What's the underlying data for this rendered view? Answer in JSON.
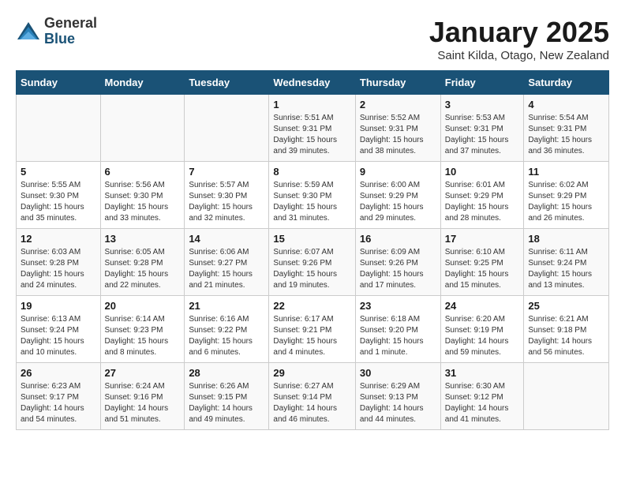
{
  "header": {
    "logo_general": "General",
    "logo_blue": "Blue",
    "month": "January 2025",
    "location": "Saint Kilda, Otago, New Zealand"
  },
  "days_of_week": [
    "Sunday",
    "Monday",
    "Tuesday",
    "Wednesday",
    "Thursday",
    "Friday",
    "Saturday"
  ],
  "weeks": [
    [
      {
        "day": "",
        "info": ""
      },
      {
        "day": "",
        "info": ""
      },
      {
        "day": "",
        "info": ""
      },
      {
        "day": "1",
        "info": "Sunrise: 5:51 AM\nSunset: 9:31 PM\nDaylight: 15 hours\nand 39 minutes."
      },
      {
        "day": "2",
        "info": "Sunrise: 5:52 AM\nSunset: 9:31 PM\nDaylight: 15 hours\nand 38 minutes."
      },
      {
        "day": "3",
        "info": "Sunrise: 5:53 AM\nSunset: 9:31 PM\nDaylight: 15 hours\nand 37 minutes."
      },
      {
        "day": "4",
        "info": "Sunrise: 5:54 AM\nSunset: 9:31 PM\nDaylight: 15 hours\nand 36 minutes."
      }
    ],
    [
      {
        "day": "5",
        "info": "Sunrise: 5:55 AM\nSunset: 9:30 PM\nDaylight: 15 hours\nand 35 minutes."
      },
      {
        "day": "6",
        "info": "Sunrise: 5:56 AM\nSunset: 9:30 PM\nDaylight: 15 hours\nand 33 minutes."
      },
      {
        "day": "7",
        "info": "Sunrise: 5:57 AM\nSunset: 9:30 PM\nDaylight: 15 hours\nand 32 minutes."
      },
      {
        "day": "8",
        "info": "Sunrise: 5:59 AM\nSunset: 9:30 PM\nDaylight: 15 hours\nand 31 minutes."
      },
      {
        "day": "9",
        "info": "Sunrise: 6:00 AM\nSunset: 9:29 PM\nDaylight: 15 hours\nand 29 minutes."
      },
      {
        "day": "10",
        "info": "Sunrise: 6:01 AM\nSunset: 9:29 PM\nDaylight: 15 hours\nand 28 minutes."
      },
      {
        "day": "11",
        "info": "Sunrise: 6:02 AM\nSunset: 9:29 PM\nDaylight: 15 hours\nand 26 minutes."
      }
    ],
    [
      {
        "day": "12",
        "info": "Sunrise: 6:03 AM\nSunset: 9:28 PM\nDaylight: 15 hours\nand 24 minutes."
      },
      {
        "day": "13",
        "info": "Sunrise: 6:05 AM\nSunset: 9:28 PM\nDaylight: 15 hours\nand 22 minutes."
      },
      {
        "day": "14",
        "info": "Sunrise: 6:06 AM\nSunset: 9:27 PM\nDaylight: 15 hours\nand 21 minutes."
      },
      {
        "day": "15",
        "info": "Sunrise: 6:07 AM\nSunset: 9:26 PM\nDaylight: 15 hours\nand 19 minutes."
      },
      {
        "day": "16",
        "info": "Sunrise: 6:09 AM\nSunset: 9:26 PM\nDaylight: 15 hours\nand 17 minutes."
      },
      {
        "day": "17",
        "info": "Sunrise: 6:10 AM\nSunset: 9:25 PM\nDaylight: 15 hours\nand 15 minutes."
      },
      {
        "day": "18",
        "info": "Sunrise: 6:11 AM\nSunset: 9:24 PM\nDaylight: 15 hours\nand 13 minutes."
      }
    ],
    [
      {
        "day": "19",
        "info": "Sunrise: 6:13 AM\nSunset: 9:24 PM\nDaylight: 15 hours\nand 10 minutes."
      },
      {
        "day": "20",
        "info": "Sunrise: 6:14 AM\nSunset: 9:23 PM\nDaylight: 15 hours\nand 8 minutes."
      },
      {
        "day": "21",
        "info": "Sunrise: 6:16 AM\nSunset: 9:22 PM\nDaylight: 15 hours\nand 6 minutes."
      },
      {
        "day": "22",
        "info": "Sunrise: 6:17 AM\nSunset: 9:21 PM\nDaylight: 15 hours\nand 4 minutes."
      },
      {
        "day": "23",
        "info": "Sunrise: 6:18 AM\nSunset: 9:20 PM\nDaylight: 15 hours\nand 1 minute."
      },
      {
        "day": "24",
        "info": "Sunrise: 6:20 AM\nSunset: 9:19 PM\nDaylight: 14 hours\nand 59 minutes."
      },
      {
        "day": "25",
        "info": "Sunrise: 6:21 AM\nSunset: 9:18 PM\nDaylight: 14 hours\nand 56 minutes."
      }
    ],
    [
      {
        "day": "26",
        "info": "Sunrise: 6:23 AM\nSunset: 9:17 PM\nDaylight: 14 hours\nand 54 minutes."
      },
      {
        "day": "27",
        "info": "Sunrise: 6:24 AM\nSunset: 9:16 PM\nDaylight: 14 hours\nand 51 minutes."
      },
      {
        "day": "28",
        "info": "Sunrise: 6:26 AM\nSunset: 9:15 PM\nDaylight: 14 hours\nand 49 minutes."
      },
      {
        "day": "29",
        "info": "Sunrise: 6:27 AM\nSunset: 9:14 PM\nDaylight: 14 hours\nand 46 minutes."
      },
      {
        "day": "30",
        "info": "Sunrise: 6:29 AM\nSunset: 9:13 PM\nDaylight: 14 hours\nand 44 minutes."
      },
      {
        "day": "31",
        "info": "Sunrise: 6:30 AM\nSunset: 9:12 PM\nDaylight: 14 hours\nand 41 minutes."
      },
      {
        "day": "",
        "info": ""
      }
    ]
  ]
}
